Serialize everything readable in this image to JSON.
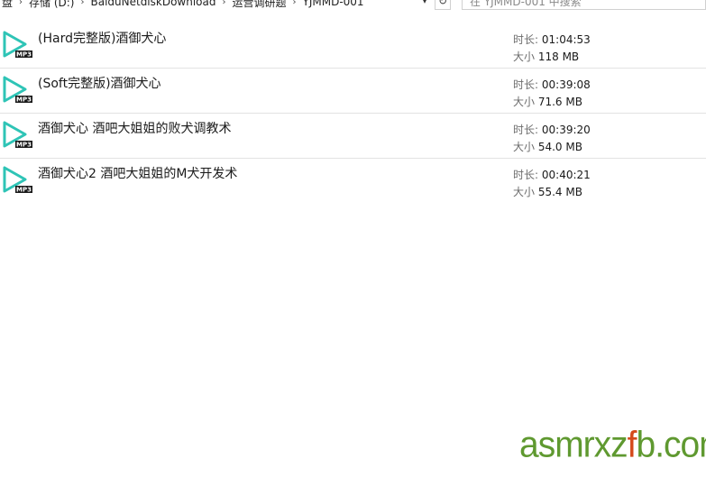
{
  "breadcrumb": {
    "items": [
      "盘",
      "存储 (D:)",
      "BaiduNetdiskDownload",
      "运营调研题",
      "YJMMD-001"
    ],
    "separator": "›"
  },
  "search": {
    "placeholder": "在 YJMMD-001 中搜索"
  },
  "icons": {
    "breadcrumb_dropdown": "chevron-down-icon",
    "refresh": "refresh-icon",
    "file": "mp3-play-icon"
  },
  "colors": {
    "icon_accent": "#2ec4b6",
    "watermark_green": "#5f9930",
    "watermark_orange": "#d44a1b"
  },
  "files": [
    {
      "name": "(Hard完整版)酒御犬心",
      "duration_label": "时长:",
      "duration": "01:04:53",
      "size_label": "大小",
      "size": "118 MB",
      "badge": "MP3"
    },
    {
      "name": "(Soft完整版)酒御犬心",
      "duration_label": "时长:",
      "duration": "00:39:08",
      "size_label": "大小",
      "size": "71.6 MB",
      "badge": "MP3"
    },
    {
      "name": "酒御犬心 酒吧大姐姐的败犬调教术",
      "duration_label": "时长:",
      "duration": "00:39:20",
      "size_label": "大小",
      "size": "54.0 MB",
      "badge": "MP3"
    },
    {
      "name": "酒御犬心2 酒吧大姐姐的M犬开发术",
      "duration_label": "时长:",
      "duration": "00:40:21",
      "size_label": "大小",
      "size": "55.4 MB",
      "badge": "MP3"
    }
  ],
  "watermark": {
    "part1": "asmrxz",
    "part2": "f",
    "part3": "b.com"
  }
}
